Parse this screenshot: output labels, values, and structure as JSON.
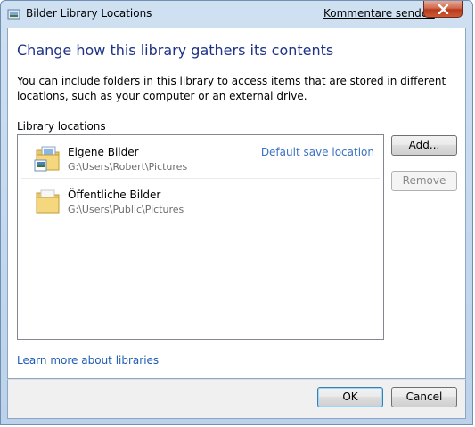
{
  "window": {
    "title": "Bilder Library Locations",
    "feedback_link": "Kommentare senden"
  },
  "main": {
    "heading": "Change how this library gathers its contents",
    "description": "You can include folders in this library to access items that are stored in different locations, such as your computer or an external drive.",
    "locations_label": "Library locations",
    "locations": [
      {
        "name": "Eigene Bilder",
        "path": "G:\\Users\\Robert\\Pictures",
        "badge": "Default save location",
        "icon": "pictures-folder-icon"
      },
      {
        "name": "Öffentliche Bilder",
        "path": "G:\\Users\\Public\\Pictures",
        "icon": "folder-icon"
      }
    ],
    "add_button": "Add...",
    "remove_button": "Remove",
    "learn_more_link": "Learn more about libraries"
  },
  "footer": {
    "ok_button": "OK",
    "cancel_button": "Cancel"
  },
  "colors": {
    "heading": "#1e3287",
    "link": "#1e5db3",
    "badge": "#3b72c2",
    "frame": "#bcd2ea",
    "close_button": "#c4482a"
  }
}
